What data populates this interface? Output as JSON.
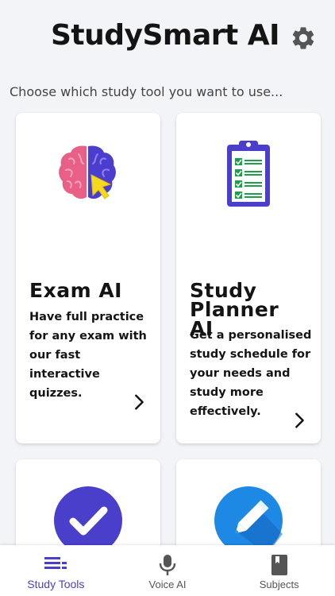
{
  "app": {
    "title": "StudySmart AI",
    "subtitle": "Choose which study tool you want to use..."
  },
  "tools": [
    {
      "title": "Exam AI",
      "description": "Have full practice for any exam with our fast interactive quizzes.",
      "icon": "brain-cursor-icon"
    },
    {
      "title": "Study Planner AI",
      "description": "Get a personalised study schedule for your needs and study more effectively.",
      "icon": "clipboard-checklist-icon"
    },
    {
      "title": "",
      "description": "",
      "icon": "checkmark-circle-icon"
    },
    {
      "title": "",
      "description": "",
      "icon": "pencil-circle-icon"
    }
  ],
  "nav": {
    "items": [
      {
        "label": "Study Tools",
        "icon": "list-icon",
        "active": true
      },
      {
        "label": "Voice AI",
        "icon": "microphone-icon",
        "active": false
      },
      {
        "label": "Subjects",
        "icon": "book-icon",
        "active": false
      }
    ]
  },
  "colors": {
    "background": "#f3f4f8",
    "accent": "#4a3fcb",
    "brain_left": "#e95f86",
    "brain_right": "#4b3ecf",
    "cursor": "#f5d820",
    "check_circle": "#4a3fcb",
    "pencil_circle": "#1e88e5"
  }
}
